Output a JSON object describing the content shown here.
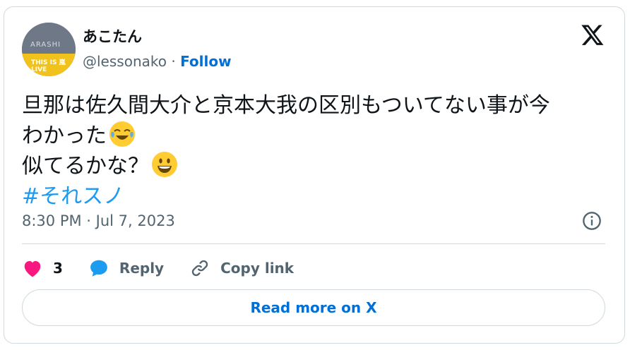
{
  "user": {
    "display_name": "あこたん",
    "handle": "@lessonako",
    "separator": " · ",
    "follow_label": "Follow",
    "avatar_text_top": "ARASHI",
    "avatar_text_bottom": "THIS IS 嵐 LIVE"
  },
  "tweet": {
    "line1": "旦那は佐久間大介と京本大我の区別もついてない事が今",
    "line2": "わかった",
    "line2_emoji": "face-with-tears-of-joy",
    "line3": "似てるかな？",
    "line3_emoji": "grinning-face",
    "hashtag": "#それスノ"
  },
  "meta": {
    "timestamp": "8:30 PM · Jul 7, 2023"
  },
  "actions": {
    "like_count": "3",
    "reply_label": "Reply",
    "copy_link_label": "Copy link"
  },
  "read_more_label": "Read more on X",
  "colors": {
    "accent": "#006fd6",
    "hashtag": "#1d9bf0",
    "like": "#f91880",
    "reply": "#1d9bf0",
    "border": "#cfd9de",
    "muted": "#536471"
  }
}
